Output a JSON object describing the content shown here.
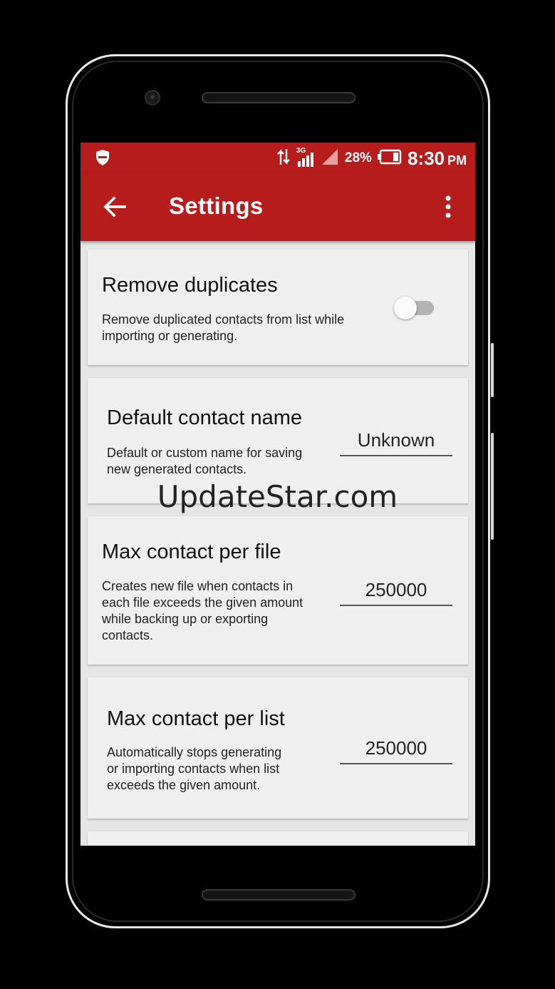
{
  "statusbar": {
    "network_type": "3G",
    "battery_percent": "28%",
    "time": "8:30",
    "ampm": "PM"
  },
  "appbar": {
    "title": "Settings"
  },
  "settings": [
    {
      "title": "Remove duplicates",
      "description_lines": [
        "Remove duplicated contacts from list while",
        "importing or generating."
      ],
      "toggle_on": false
    },
    {
      "title": "Default contact name",
      "description_lines": [
        "Default or custom name for saving",
        "new generated contacts."
      ],
      "value": "Unknown"
    },
    {
      "title": "Max contact per file",
      "description_lines": [
        "Creates new file when contacts in",
        "each file exceeds the given amount",
        "while backing up or exporting",
        "contacts."
      ],
      "value": "250000"
    },
    {
      "title": "Max contact per list",
      "description_lines": [
        "Automatically stops generating",
        "or importing contacts when list",
        "exceeds the given amount."
      ],
      "value": "250000"
    }
  ],
  "watermark": "UpdateStar.com",
  "colors": {
    "primary": "#b71c1c",
    "background": "#e5e5e5",
    "card": "#efefef"
  }
}
